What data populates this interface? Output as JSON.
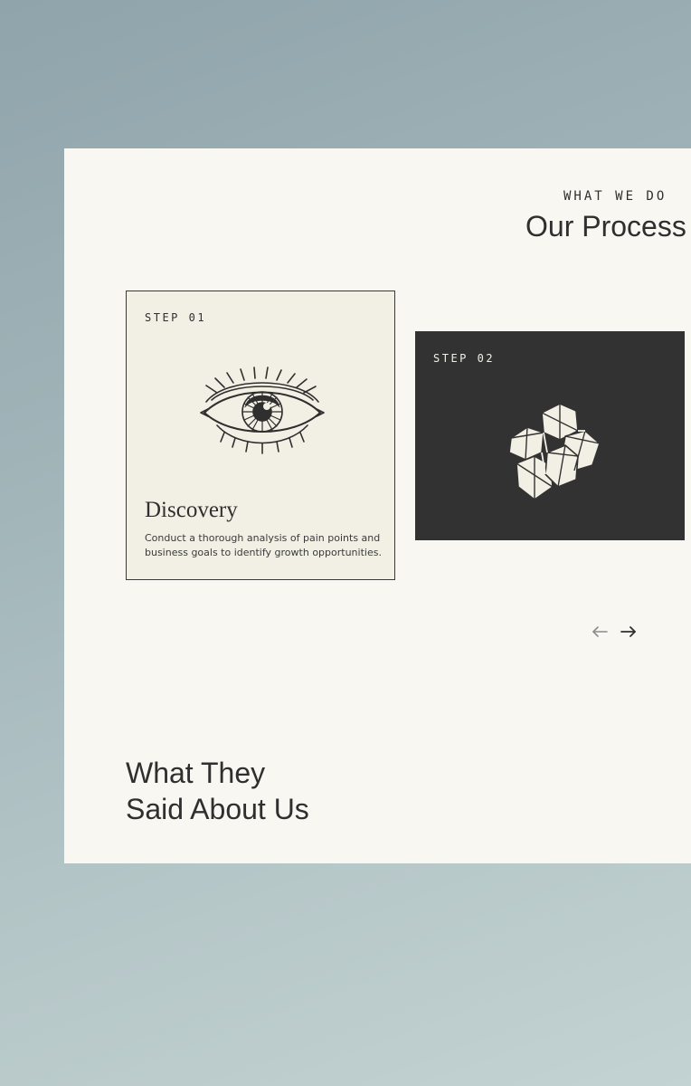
{
  "process": {
    "eyebrow": "WHAT WE DO",
    "title": "Our Process",
    "cards": [
      {
        "step": "STEP 01",
        "icon": "eye-icon",
        "title": "Discovery",
        "description": "Conduct a thorough analysis of pain points and business goals to identify growth opportunities."
      },
      {
        "step": "STEP 02",
        "icon": "crystal-cluster-icon"
      }
    ],
    "navigation": {
      "prev_icon": "arrow-left-icon",
      "next_icon": "arrow-right-icon"
    }
  },
  "testimonials": {
    "title_line_1": "What They",
    "title_line_2": "Said About Us"
  },
  "colors": {
    "background_start": "#8fa4ab",
    "background_end": "#c3d2d2",
    "panel": "#f8f7f2",
    "card_light": "#f2f0e5",
    "card_dark": "#323232",
    "text": "#2f2f2f"
  }
}
